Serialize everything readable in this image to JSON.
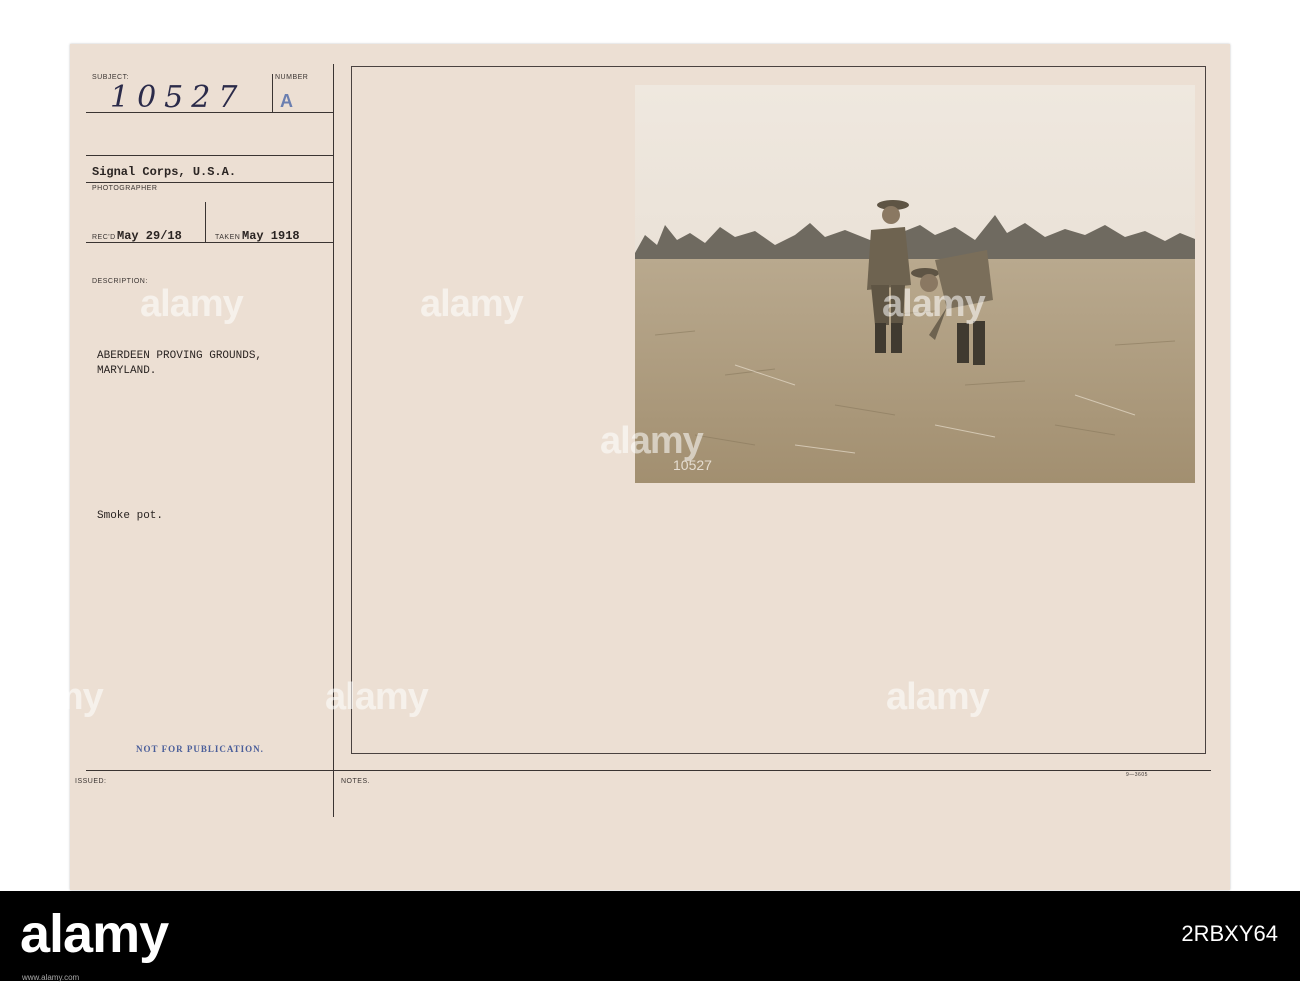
{
  "card": {
    "subject_label": "SUBJECT:",
    "subject_number": "10527",
    "number_label": "NUMBER",
    "number_value": "A",
    "photographer": "Signal Corps, U.S.A.",
    "photographer_label": "PHOTOGRAPHER",
    "recd_label": "REC'D",
    "recd_date": "May 29/18",
    "taken_label": "TAKEN",
    "taken_date": "May 1918",
    "description_label": "DESCRIPTION:",
    "location_line1": "ABERDEEN PROVING GROUNDS,",
    "location_line2": "MARYLAND.",
    "caption": "Smoke pot.",
    "not_for_publication": "NOT FOR PUBLICATION.",
    "issued_label": "ISSUED:",
    "notes_label": "NOTES.",
    "form_number": "9—3605"
  },
  "photo": {
    "negative_number": "10527"
  },
  "watermark": {
    "text": "alamy"
  },
  "footer": {
    "logo": "alamy",
    "image_id": "2RBXY64",
    "url": "www.alamy.com"
  },
  "colors": {
    "card": "#ecdfd3",
    "ink": "#2a2422",
    "blue_stamp": "#4a5e9a",
    "footer": "#000000"
  }
}
